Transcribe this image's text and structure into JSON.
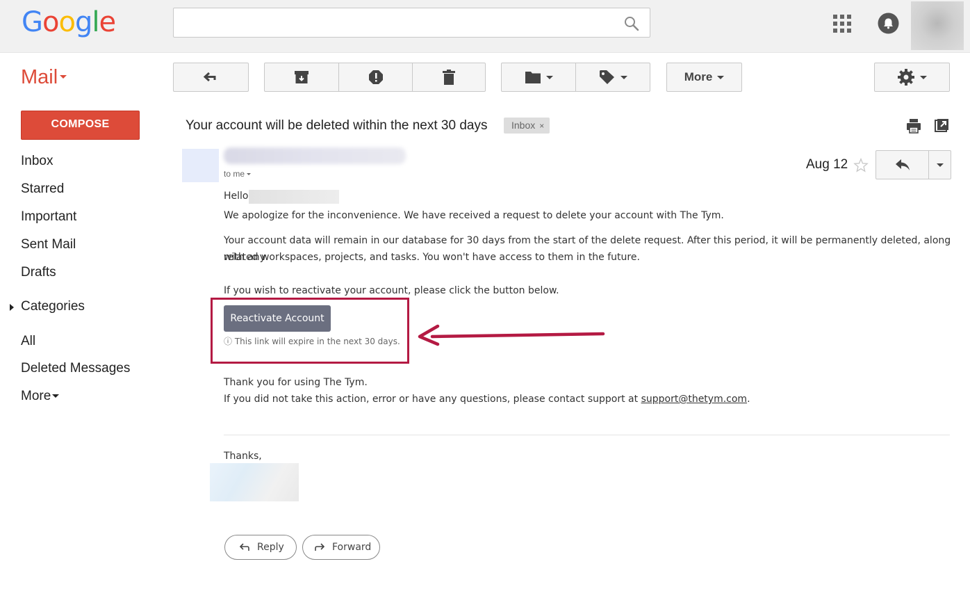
{
  "header": {
    "logo_letters": [
      "G",
      "o",
      "o",
      "g",
      "l",
      "e"
    ],
    "logo_colors": [
      "#4285f4",
      "#ea4335",
      "#fbbc05",
      "#4285f4",
      "#34a853",
      "#ea4335"
    ],
    "search_value": "",
    "icons": [
      "search-icon",
      "apps-grid-icon",
      "notifications-bell-icon"
    ]
  },
  "sidebar": {
    "mail_label": "Mail",
    "compose_label": "COMPOSE",
    "items": [
      {
        "label": "Inbox"
      },
      {
        "label": "Starred"
      },
      {
        "label": "Important"
      },
      {
        "label": "Sent Mail"
      },
      {
        "label": "Drafts"
      },
      {
        "label": "Categories"
      },
      {
        "label": "All"
      },
      {
        "label": "Deleted Messages"
      },
      {
        "label": "More"
      }
    ]
  },
  "toolbar": {
    "more_label": "More",
    "icons": [
      "back-arrow-icon",
      "archive-icon",
      "report-spam-icon",
      "delete-icon",
      "move-to-folder-icon",
      "labels-icon",
      "settings-gear-icon"
    ]
  },
  "message": {
    "subject": "Your account will be deleted within the next 30 days",
    "label_chip": "Inbox",
    "label_remove": "×",
    "to_line": "to me",
    "date": "Aug 12",
    "greeting": "Hello",
    "para1": "We apologize for the inconvenience. We have received a request to delete your account with The Tym.",
    "para2_line1": "Your account data will remain in our database for 30 days from the start of the delete request. After this period, it will be permanently deleted, along with any",
    "para2_line2": "related workspaces, projects, and tasks. You won't have access to them in the future.",
    "para3": "If you wish to reactivate your account, please click the button below.",
    "reactivate_button": "Reactivate Account",
    "expire_icon": "ⓘ",
    "expire_note": "This link will expire in the next 30 days.",
    "thanks_line": "Thank you for using The Tym.",
    "support_prefix": "If you did not take this action, error or have any questions, please contact support at ",
    "support_email": "support@thetym.com",
    "support_suffix": ".",
    "signoff": "Thanks,",
    "reply_label": "Reply",
    "forward_label": "Forward"
  },
  "colors": {
    "brand_red": "#dd4b39",
    "annotation": "#b41a43",
    "button_gray": "#6b6f80"
  }
}
